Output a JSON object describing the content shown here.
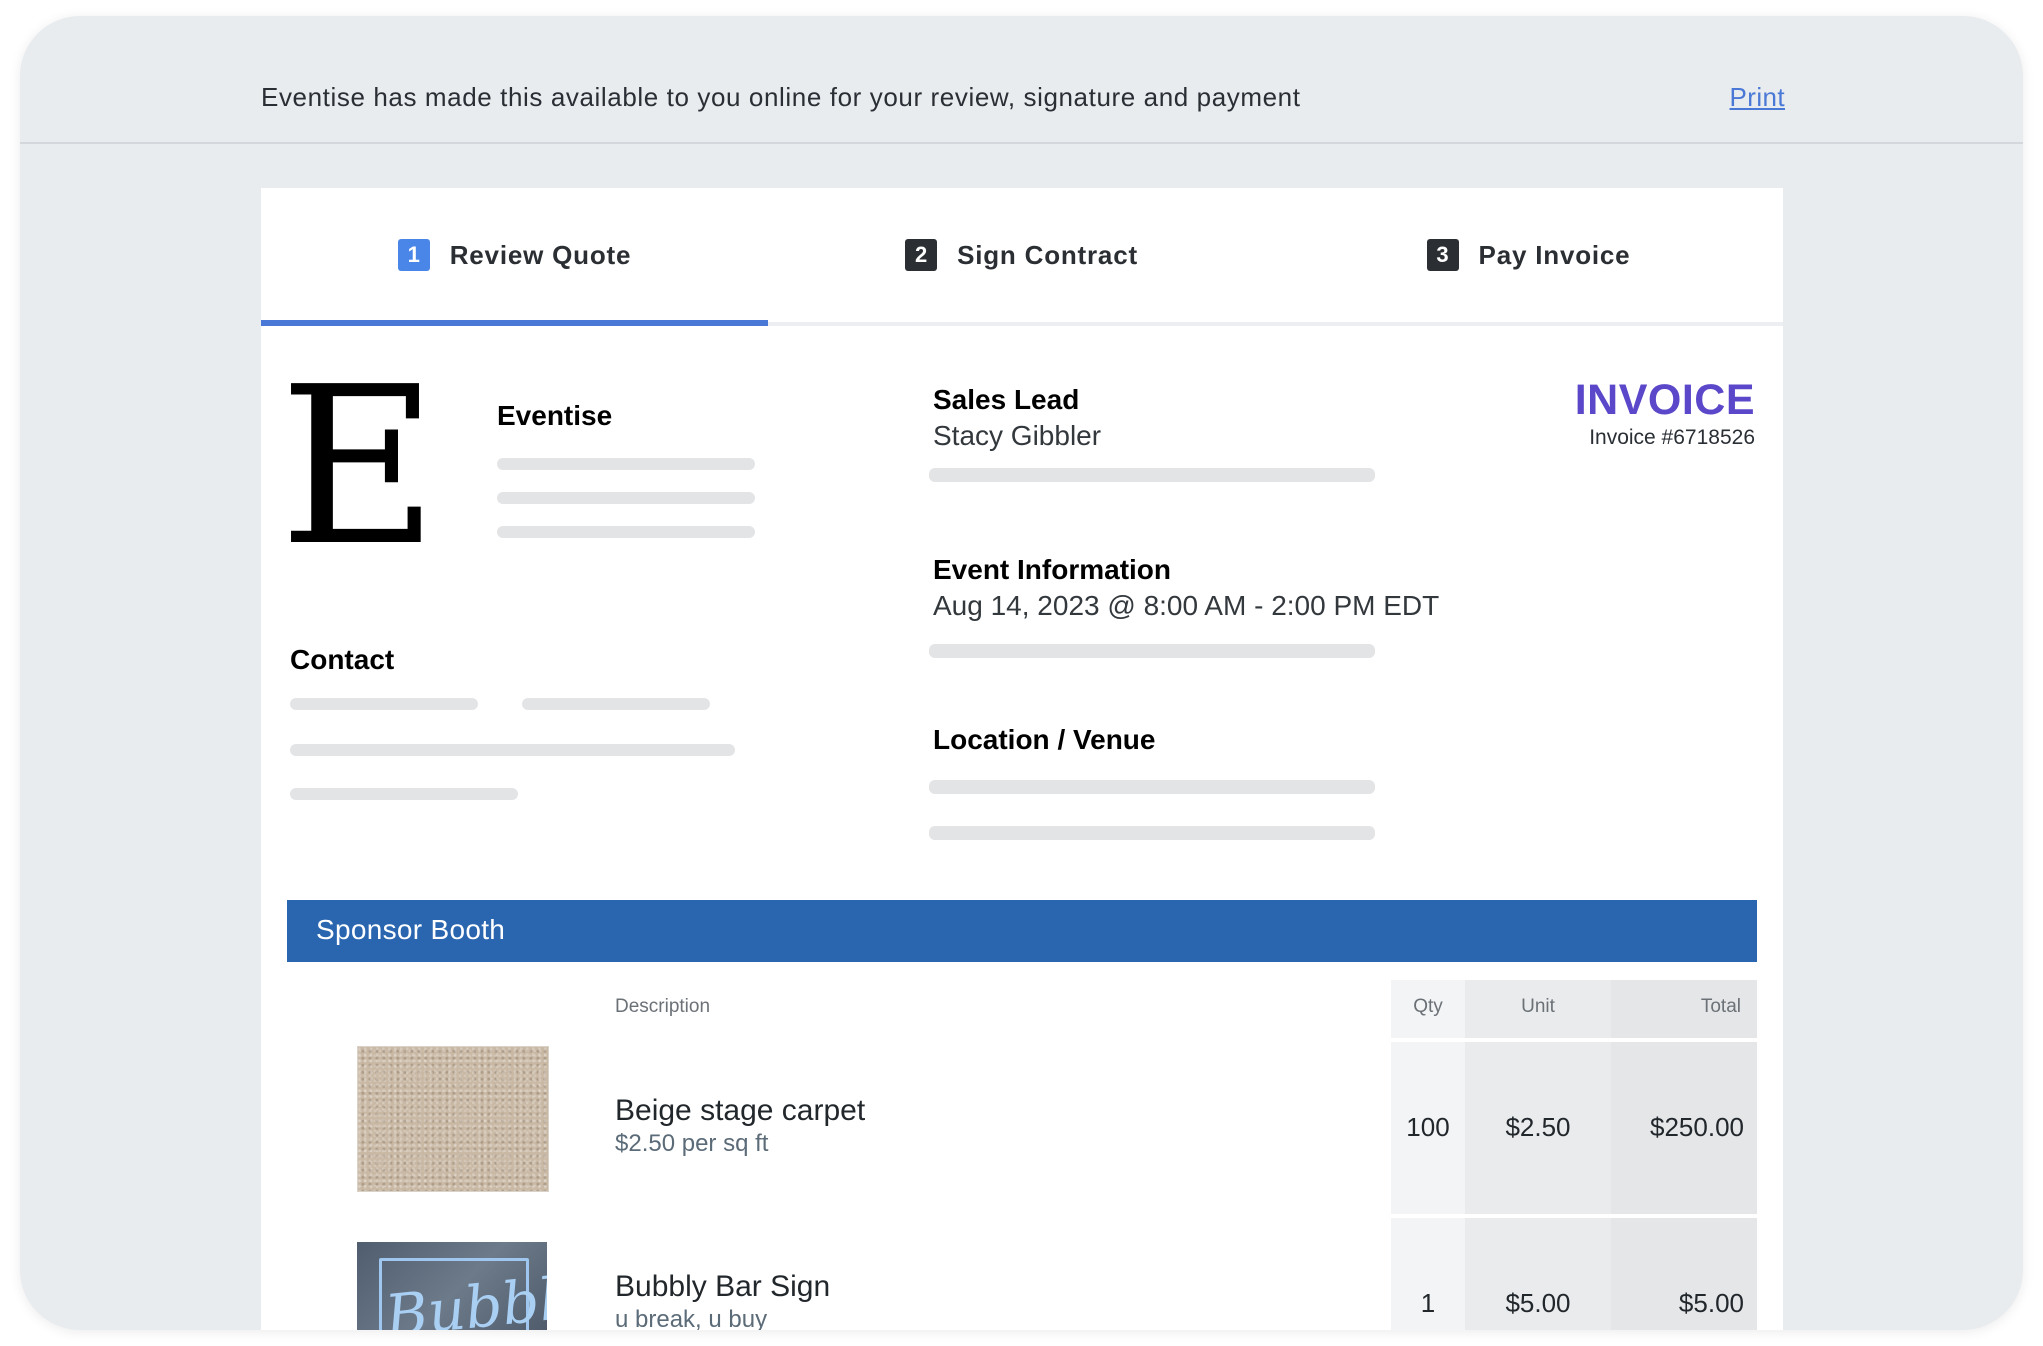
{
  "banner": {
    "message": "Eventise has made this available to you online for your review, signature and payment",
    "print_label": "Print"
  },
  "steps": [
    {
      "number": "1",
      "label": "Review Quote",
      "active": true
    },
    {
      "number": "2",
      "label": "Sign Contract",
      "active": false
    },
    {
      "number": "3",
      "label": "Pay Invoice",
      "active": false
    }
  ],
  "company": {
    "logo_letter": "E",
    "name": "Eventise"
  },
  "contact": {
    "heading": "Contact"
  },
  "sales_lead": {
    "heading": "Sales Lead",
    "value": "Stacy Gibbler"
  },
  "event_info": {
    "heading": "Event Information",
    "value": "Aug 14, 2023 @ 8:00 AM - 2:00 PM EDT"
  },
  "location": {
    "heading": "Location / Venue"
  },
  "invoice": {
    "title": "INVOICE",
    "number": "Invoice #6718526"
  },
  "section": {
    "title": "Sponsor Booth",
    "columns": {
      "description": "Description",
      "qty": "Qty",
      "unit": "Unit",
      "total": "Total"
    },
    "items": [
      {
        "name": "Beige stage carpet",
        "subtitle": "$2.50 per sq ft",
        "qty": "100",
        "unit": "$2.50",
        "total": "$250.00",
        "thumbnail_icon": "carpet-image"
      },
      {
        "name": "Bubbly Bar Sign",
        "subtitle": "u break, u buy",
        "qty": "1",
        "unit": "$5.00",
        "total": "$5.00",
        "thumbnail_icon": "neon-sign-image",
        "thumbnail_text": "Bubbly"
      }
    ]
  },
  "colors": {
    "accent_blue": "#4a78d6",
    "section_bar": "#2a66b0",
    "invoice_purple": "#5a47c9",
    "page_background": "#e9ecef"
  }
}
